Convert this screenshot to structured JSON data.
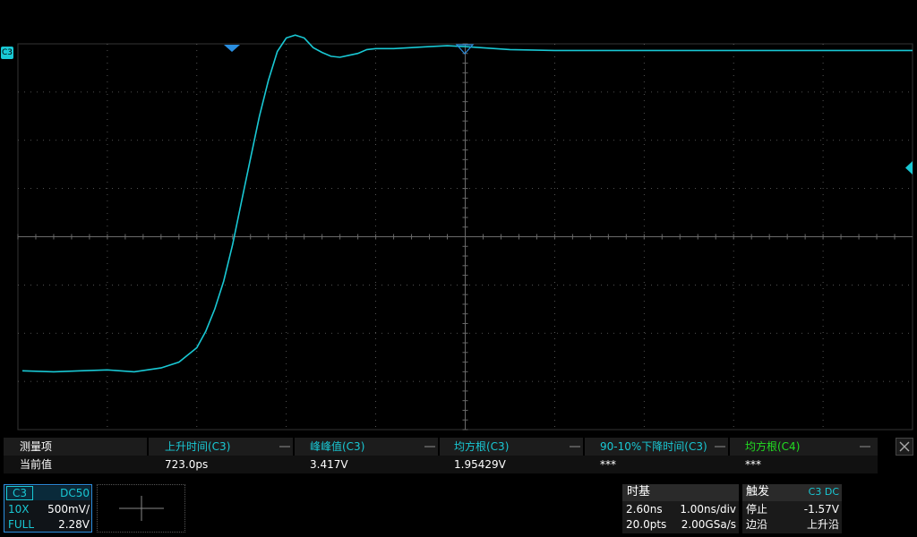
{
  "channel": {
    "tag": "C3",
    "coupling": "DC50",
    "probe": "10X",
    "scale": "500mV/",
    "bandwidth": "FULL",
    "offset": "2.28V"
  },
  "measurements": {
    "row_header": "测量项",
    "row_value": "当前值",
    "columns": [
      {
        "name": "上升时间(C3)",
        "value": "723.0ps",
        "color": "#19c8d4"
      },
      {
        "name": "峰峰值(C3)",
        "value": "3.417V",
        "color": "#19c8d4"
      },
      {
        "name": "均方根(C3)",
        "value": "1.95429V",
        "color": "#19c8d4"
      },
      {
        "name": "90-10%下降时间(C3)",
        "value": "***",
        "color": "#19c8d4"
      },
      {
        "name": "均方根(C4)",
        "value": "***",
        "color": "#22dd22"
      }
    ]
  },
  "timebase": {
    "title": "时基",
    "delay": "2.60ns",
    "scale": "1.00ns/div",
    "points": "20.0pts",
    "sample_rate": "2.00GSa/s"
  },
  "trigger": {
    "title": "触发",
    "source": "C3 DC",
    "state": "停止",
    "level": "-1.57V",
    "type_label": "边沿",
    "slope": "上升沿"
  },
  "colors": {
    "trace": "#19c8d4",
    "grid": "#6a6a6a",
    "trigger_marker": "#2a8ee0",
    "c4": "#22dd22"
  },
  "waveform": {
    "time_ns": [
      -4.95,
      -4.6,
      -4.3,
      -4.0,
      -3.7,
      -3.4,
      -3.2,
      -3.0,
      -2.9,
      -2.8,
      -2.7,
      -2.6,
      -2.5,
      -2.4,
      -2.3,
      -2.2,
      -2.1,
      -2.0,
      -1.9,
      -1.8,
      -1.7,
      -1.6,
      -1.5,
      -1.4,
      -1.3,
      -1.2,
      -1.1,
      -1.0,
      -0.8,
      -0.6,
      -0.4,
      -0.2,
      0.0,
      0.5,
      1.0,
      2.0,
      3.0,
      4.0,
      5.0
    ],
    "volts": [
      -1.39,
      -1.4,
      -1.39,
      -1.38,
      -1.4,
      -1.36,
      -1.3,
      -1.15,
      -0.98,
      -0.75,
      -0.46,
      -0.08,
      0.37,
      0.81,
      1.25,
      1.62,
      1.92,
      2.06,
      2.09,
      2.06,
      1.96,
      1.91,
      1.87,
      1.86,
      1.88,
      1.9,
      1.94,
      1.95,
      1.95,
      1.96,
      1.97,
      1.98,
      1.97,
      1.94,
      1.93,
      1.93,
      1.93,
      1.93,
      1.93
    ]
  }
}
